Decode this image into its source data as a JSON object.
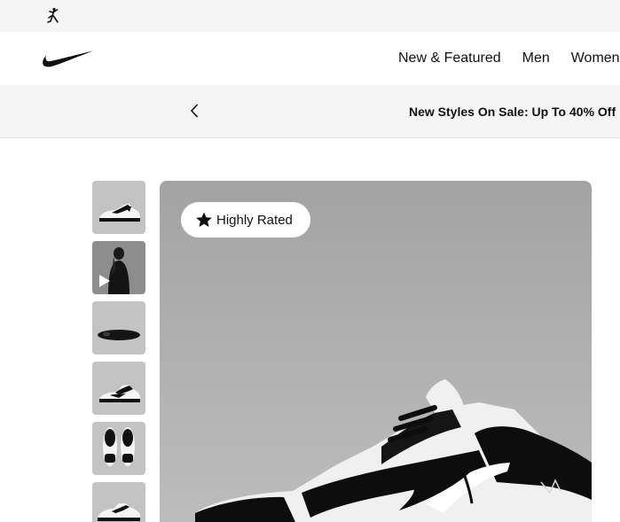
{
  "brand_bar": {
    "logo_icon": "jordan-jumpman-icon"
  },
  "header": {
    "logo_icon": "nike-swoosh-icon",
    "nav": [
      {
        "label": "New & Featured"
      },
      {
        "label": "Men"
      },
      {
        "label": "Women"
      }
    ]
  },
  "promo": {
    "prev_icon": "chevron-left-icon",
    "text": "New Styles On Sale: Up To 40% Off"
  },
  "gallery": {
    "thumbnails": [
      {
        "alt": "shoe-side-view"
      },
      {
        "alt": "video-model",
        "icon": "play-icon"
      },
      {
        "alt": "shoe-sole"
      },
      {
        "alt": "shoe-medial-view"
      },
      {
        "alt": "shoe-top-view"
      },
      {
        "alt": "shoe-pair"
      }
    ],
    "badge": {
      "icon": "star-icon",
      "label": "Highly Rated"
    }
  },
  "colors": {
    "brand_bar_bg": "#f5f5f5",
    "promo_bg": "#f5f5f5",
    "text": "#111111",
    "hero_bg": "#a8a8a8"
  }
}
